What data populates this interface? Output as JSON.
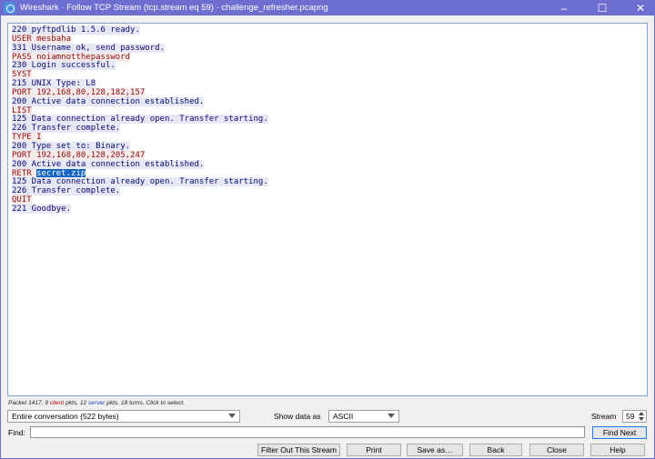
{
  "window": {
    "title": "Wireshark · Follow TCP Stream (tcp.stream eq 59) · challenge_refresher.pcapng",
    "minimize_glyph": "–",
    "maximize_glyph": "☐",
    "close_glyph": "✕"
  },
  "stream": {
    "lines": [
      {
        "dir": "server",
        "text": "220 pyftpdlib 1.5.6 ready."
      },
      {
        "dir": "client",
        "text": "USER mesbaha"
      },
      {
        "dir": "server",
        "text": "331 Username ok, send password."
      },
      {
        "dir": "client",
        "text": "PASS noiamnotthepassword"
      },
      {
        "dir": "server",
        "text": "230 Login successful."
      },
      {
        "dir": "client",
        "text": "SYST"
      },
      {
        "dir": "server",
        "text": "215 UNIX Type: L8"
      },
      {
        "dir": "client",
        "text": "PORT 192,168,80,128,182,157"
      },
      {
        "dir": "server",
        "text": "200 Active data connection established."
      },
      {
        "dir": "client",
        "text": "LIST"
      },
      {
        "dir": "server",
        "text": "125 Data connection already open. Transfer starting."
      },
      {
        "dir": "server",
        "text": "226 Transfer complete."
      },
      {
        "dir": "client",
        "text": "TYPE I"
      },
      {
        "dir": "server",
        "text": "200 Type set to: Binary."
      },
      {
        "dir": "client",
        "text": "PORT 192,168,80,128,205,247"
      },
      {
        "dir": "server",
        "text": "200 Active data connection established."
      },
      {
        "dir": "client",
        "text": "RETR ",
        "highlight": "secret.zip"
      },
      {
        "dir": "server",
        "text": "125 Data connection already open. Transfer starting."
      },
      {
        "dir": "server",
        "text": "226 Transfer complete."
      },
      {
        "dir": "client",
        "text": "QUIT"
      },
      {
        "dir": "server",
        "text": "221 Goodbye."
      }
    ]
  },
  "info": {
    "prefix": "Packet 1417. 9 ",
    "client_word": "client",
    "middle": " pkts, 12 ",
    "server_word": "server",
    "suffix": " pkts, 18 turns. Click to select."
  },
  "controls": {
    "conversation_select": "Entire conversation (522 bytes)",
    "show_data_label": "Show data as",
    "show_data_select": "ASCII",
    "stream_label": "Stream",
    "stream_value": "59",
    "find_label": "Find:",
    "find_value": "",
    "find_next_label": "Find Next"
  },
  "buttons": {
    "filter_out": "Filter Out This Stream",
    "print": "Print",
    "save_as": "Save as…",
    "back": "Back",
    "close": "Close",
    "help": "Help"
  },
  "colors": {
    "titlebar": "#6d6fd0",
    "client_text": "#8b0e0e",
    "server_text": "#0a0a6e",
    "selection": "#1565c0"
  }
}
